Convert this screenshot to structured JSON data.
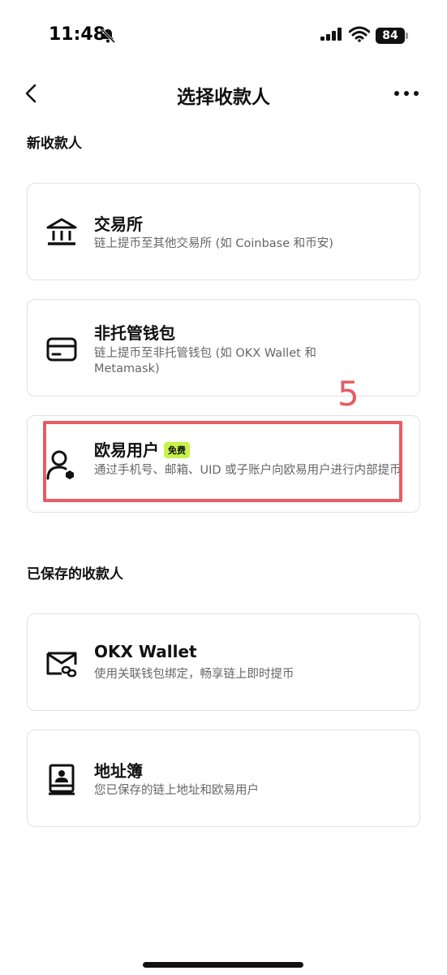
{
  "status": {
    "time": "11:48",
    "battery": "84"
  },
  "nav": {
    "title": "选择收款人"
  },
  "sections": {
    "new": "新收款人",
    "saved": "已保存的收款人"
  },
  "cards": {
    "exchange": {
      "title": "交易所",
      "desc": "链上提币至其他交易所 (如 Coinbase 和币安)"
    },
    "wallet": {
      "title": "非托管钱包",
      "desc": "链上提币至非托管钱包 (如 OKX Wallet 和 Metamask)"
    },
    "okx_user": {
      "title": "欧易用户",
      "badge": "免费",
      "desc": "通过手机号、邮箱、UID 或子账户向欧易用户进行内部提币"
    },
    "okx_wallet": {
      "title": "OKX Wallet",
      "desc": "使用关联钱包绑定，畅享链上即时提币"
    },
    "address_book": {
      "title": "地址簿",
      "desc": "您已保存的链上地址和欧易用户"
    }
  },
  "annotation": {
    "number": "5"
  },
  "colors": {
    "badge": "#c6f34a",
    "annotation": "#e85c63"
  },
  "icons": [
    "bell-slash-icon",
    "signal-icon",
    "wifi-icon",
    "battery-icon",
    "back-chevron-icon",
    "more-icon",
    "bank-icon",
    "card-icon",
    "user-shield-icon",
    "wallet-link-icon",
    "contact-book-icon"
  ]
}
